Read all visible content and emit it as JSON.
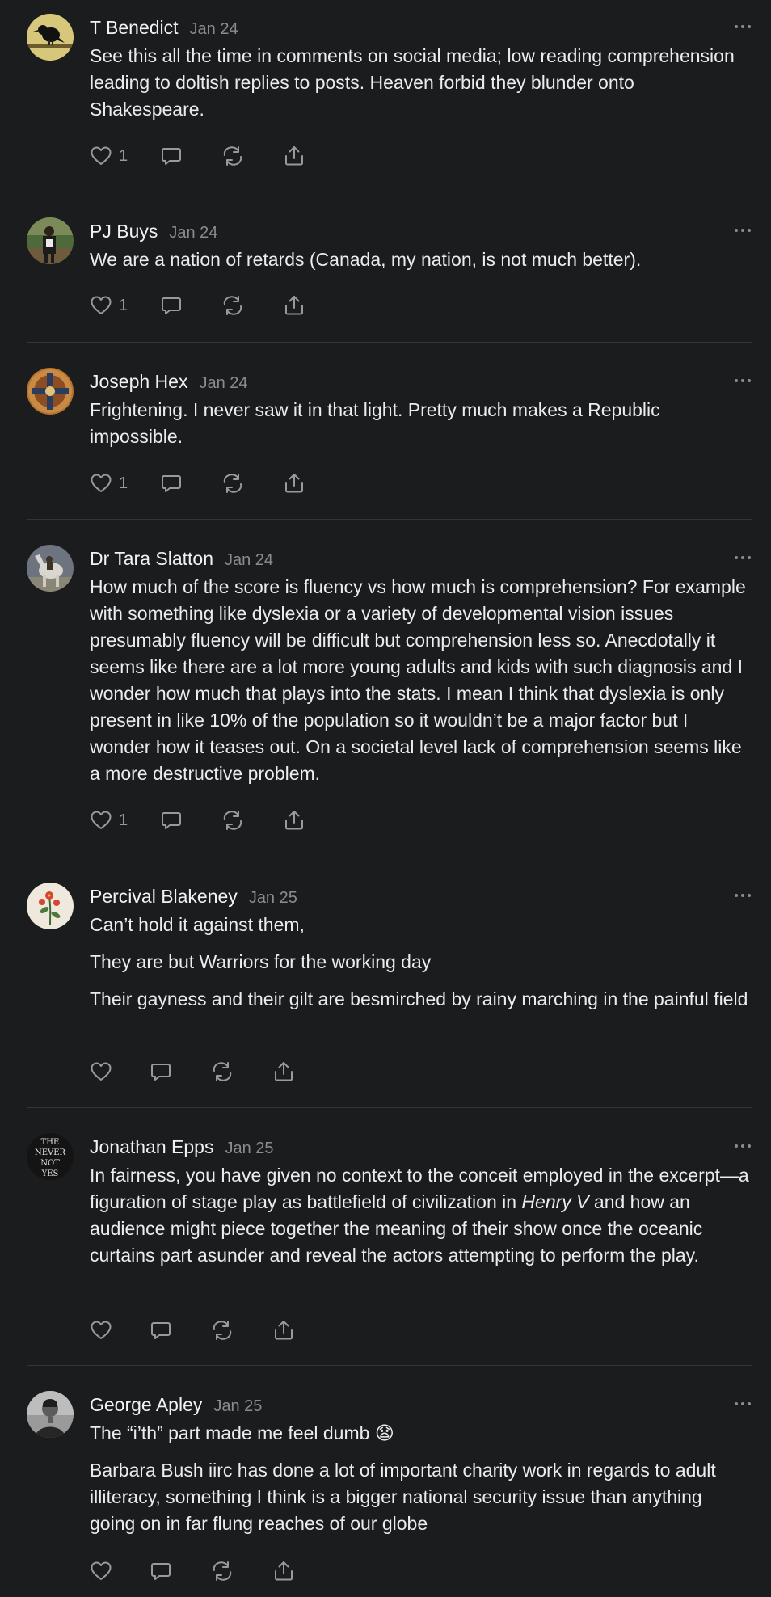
{
  "comments": [
    {
      "author": "T Benedict",
      "date": "Jan 24",
      "paragraphs": [
        "See this all the time in comments on social media; low reading comprehension leading to doltish replies to posts. Heaven forbid they blunder onto Shakespeare."
      ],
      "likes": "1"
    },
    {
      "author": "PJ Buys",
      "date": "Jan 24",
      "paragraphs": [
        "We are a nation of retards (Canada, my nation, is not much better)."
      ],
      "likes": "1"
    },
    {
      "author": "Joseph Hex",
      "date": "Jan 24",
      "paragraphs": [
        "Frightening. I never saw it in that light. Pretty much makes a Republic impossible."
      ],
      "likes": "1"
    },
    {
      "author": "Dr Tara Slatton",
      "date": "Jan 24",
      "paragraphs": [
        "How much of the score is fluency vs how much is comprehension? For example with something like dyslexia or a variety of developmental vision issues presumably fluency will be difficult but comprehension less so. Anecdotally it seems like there are a lot more young adults and kids with such diagnosis and I wonder how much that plays into the stats. I mean I think that dyslexia is only present in like 10% of the population so it wouldn’t be a major factor but I wonder how it teases out. On a societal level lack of comprehension seems like a more destructive problem."
      ],
      "likes": "1"
    },
    {
      "author": "Percival Blakeney",
      "date": "Jan 25",
      "paragraphs": [
        "Can’t hold it against them,",
        "They are but Warriors for the working day",
        "Their gayness and their gilt are besmirched by rainy marching in the painful field"
      ],
      "likes": ""
    },
    {
      "author": "Jonathan Epps",
      "date": "Jan 25",
      "paragraphs": [],
      "body_parts": {
        "before": "In fairness, you have given no context to the conceit employed in the excerpt—a figuration of stage play as battlefield of civilization in ",
        "title": "Henry V",
        "after": " and how an audience might piece together the meaning of their show once the oceanic curtains part asunder and reveal the actors attempting to perform the play."
      },
      "avatar_text": [
        "THE",
        "NEVER",
        "NOT",
        "YES"
      ],
      "likes": ""
    },
    {
      "author": "George Apley",
      "date": "Jan 25",
      "paragraphs": [
        "The “i’th” part made me feel dumb 😧",
        "Barbara Bush iirc has done a lot of important charity work in regards to adult illiteracy, something I think is a bigger national security issue than anything going on in far flung reaches of our globe"
      ],
      "likes": ""
    }
  ],
  "icons": {
    "like": "heart-icon",
    "reply": "reply-icon",
    "restack": "restack-icon",
    "share": "share-icon",
    "more": "more-dots-icon"
  },
  "colors": {
    "background": "#1b1c1e",
    "text": "#ececec",
    "muted": "#8c8c8f",
    "divider": "#333437"
  }
}
